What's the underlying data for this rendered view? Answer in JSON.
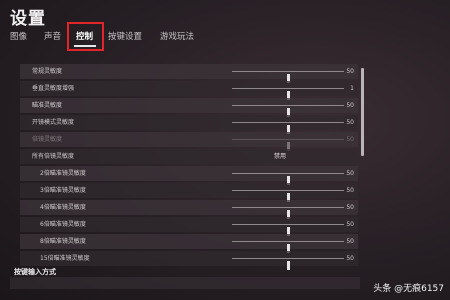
{
  "header": {
    "title": "设置"
  },
  "tabs": [
    {
      "label": "图像",
      "active": false
    },
    {
      "label": "声音",
      "active": false
    },
    {
      "label": "控制",
      "active": true
    },
    {
      "label": "按键设置",
      "active": false
    },
    {
      "label": "游戏玩法",
      "active": false
    }
  ],
  "settings": [
    {
      "label": "常规灵敏度",
      "value": "50",
      "level": 0.5,
      "enabled": true
    },
    {
      "label": "垂直灵敏度增强",
      "value": "1",
      "level": 0.5,
      "enabled": true
    },
    {
      "label": "瞄准灵敏度",
      "value": "50",
      "level": 0.5,
      "enabled": true
    },
    {
      "label": "开镜模式灵敏度",
      "value": "50",
      "level": 0.5,
      "enabled": true
    },
    {
      "label": "倍镜灵敏度",
      "value": "50",
      "level": 0.5,
      "enabled": false
    },
    {
      "label": "所有倍镜灵敏度",
      "select": "禁用",
      "enabled": true
    },
    {
      "label": "2倍瞄准镜灵敏度",
      "value": "50",
      "level": 0.5,
      "enabled": true
    },
    {
      "label": "3倍瞄准镜灵敏度",
      "value": "50",
      "level": 0.5,
      "enabled": true
    },
    {
      "label": "4倍瞄准镜灵敏度",
      "value": "50",
      "level": 0.5,
      "enabled": true
    },
    {
      "label": "6倍瞄准镜灵敏度",
      "value": "50",
      "level": 0.5,
      "enabled": true
    },
    {
      "label": "8倍瞄准镜灵敏度",
      "value": "50",
      "level": 0.5,
      "enabled": true
    },
    {
      "label": "15倍瞄准镜灵敏度",
      "value": "50",
      "level": 0.5,
      "enabled": true
    }
  ],
  "section_title": "按键输入方式",
  "watermark": {
    "text": "头条 @无痕6157"
  },
  "colors": {
    "highlight": "#e0262b",
    "background": "#231d22"
  }
}
